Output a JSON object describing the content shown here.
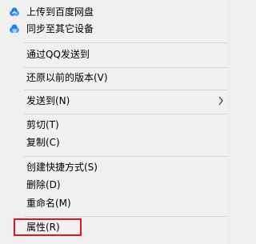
{
  "context_menu": {
    "items": [
      {
        "label": "上传到百度网盘",
        "icon": "baidu-netdisk-icon"
      },
      {
        "label": "同步至其它设备",
        "icon": "baidu-netdisk-icon"
      },
      {
        "label": "通过QQ发送到"
      },
      {
        "label": "还原以前的版本(V)"
      },
      {
        "label": "发送到(N)",
        "submenu_icon": "chevron-right-icon"
      },
      {
        "label": "剪切(T)"
      },
      {
        "label": "复制(C)"
      },
      {
        "label": "创建快捷方式(S)"
      },
      {
        "label": "删除(D)"
      },
      {
        "label": "重命名(M)"
      },
      {
        "label": "属性(R)"
      }
    ],
    "highlight_color": "#e81123",
    "icon_color": "#2b8be8"
  }
}
